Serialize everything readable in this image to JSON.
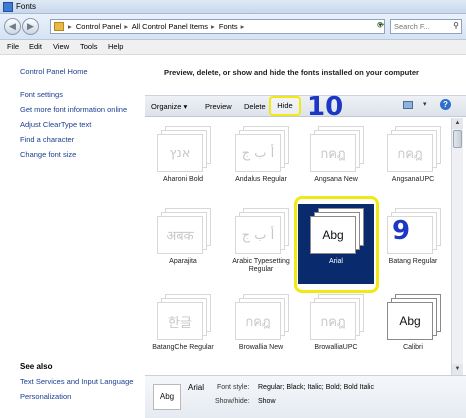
{
  "window": {
    "title": "Fonts"
  },
  "address": {
    "crumbs": [
      "Control Panel",
      "All Control Panel Items",
      "Fonts"
    ],
    "search_placeholder": "Search F..."
  },
  "menu": {
    "items": [
      "File",
      "Edit",
      "View",
      "Tools",
      "Help"
    ]
  },
  "sidebar": {
    "links": [
      "Control Panel Home",
      "Font settings",
      "Get more font information online",
      "Adjust ClearType text",
      "Find a character",
      "Change font size"
    ],
    "see_also_title": "See also",
    "see_also_links": [
      "Text Services and Input Language",
      "Personalization"
    ]
  },
  "main": {
    "heading": "Preview, delete, or show and hide the fonts installed on your computer",
    "toolbar": {
      "organize": "Organize",
      "preview": "Preview",
      "delete": "Delete",
      "hide": "Hide"
    }
  },
  "annotations": {
    "step_hide": "10",
    "step_select": "9"
  },
  "fonts": [
    {
      "name": "Aharoni Bold",
      "sample": "אנץ"
    },
    {
      "name": "Andalus Regular",
      "sample": "أ ب ج"
    },
    {
      "name": "Angsana New",
      "sample": "กคฎ"
    },
    {
      "name": "AngsanaUPC",
      "sample": "กคฎ"
    },
    {
      "name": "Aparajita",
      "sample": "अबक"
    },
    {
      "name": "Arabic Typesetting Regular",
      "sample": "أ ب ج"
    },
    {
      "name": "Arial",
      "sample": "Abg"
    },
    {
      "name": "Batang Regular",
      "sample": ""
    },
    {
      "name": "BatangChe Regular",
      "sample": "한글"
    },
    {
      "name": "Browallia New",
      "sample": "กคฎ"
    },
    {
      "name": "BrowalliaUPC",
      "sample": "กคฎ"
    },
    {
      "name": "Calibri",
      "sample": "Abg"
    }
  ],
  "details": {
    "thumb": "Abg",
    "name": "Arial",
    "style_label": "Font style:",
    "style_value": "Regular; Black; Italic; Bold; Bold Italic",
    "show_label": "Show/hide:",
    "show_value": "Show"
  },
  "colors": {
    "selection": "#0a2a6e",
    "highlight": "#f1ea12",
    "annotation": "#1b37c4",
    "link": "#1b3f91"
  }
}
